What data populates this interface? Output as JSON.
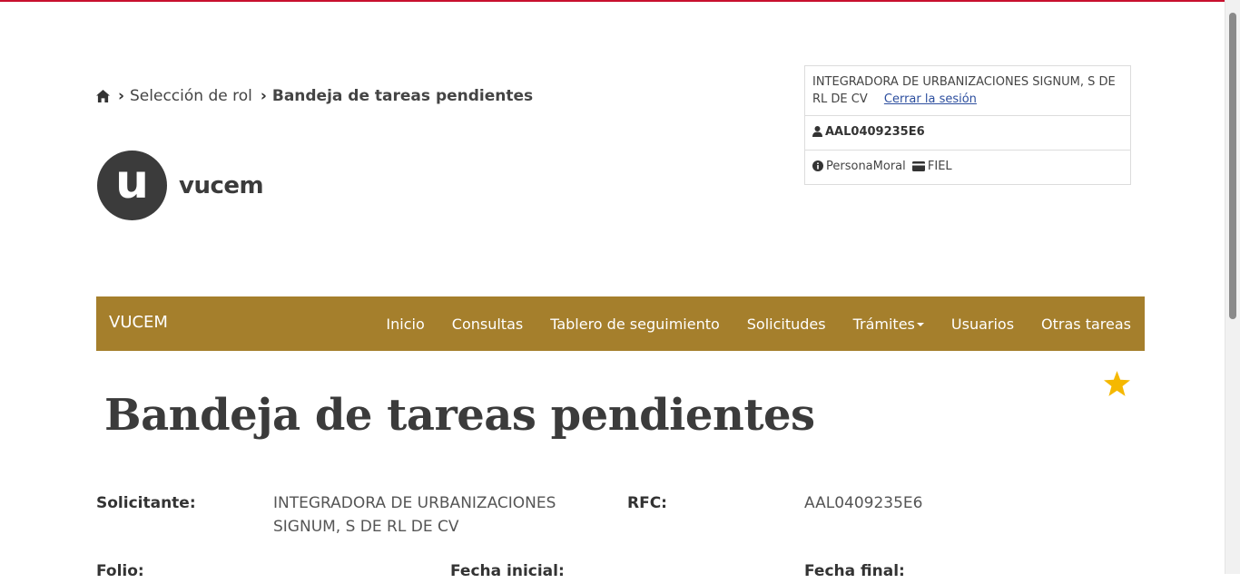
{
  "breadcrumb": {
    "items": [
      "Selección de rol",
      "Bandeja de tareas pendientes"
    ]
  },
  "logo": {
    "letter": "u",
    "text": "vucem"
  },
  "user_panel": {
    "company": "INTEGRADORA DE URBANIZACIONES SIGNUM, S DE RL DE CV",
    "logout_label": "Cerrar la sesión",
    "rfc": "AAL0409235E6",
    "person_type": "PersonaMoral",
    "auth_type": "FIEL"
  },
  "navbar": {
    "brand": "VUCEM",
    "items": [
      "Inicio",
      "Consultas",
      "Tablero de seguimiento",
      "Solicitudes",
      "Trámites",
      "Usuarios",
      "Otras tareas"
    ]
  },
  "page": {
    "title": "Bandeja de tareas pendientes",
    "favorite_icon": "star-icon"
  },
  "details": {
    "solicitante_label": "Solicitante:",
    "solicitante_value": "INTEGRADORA DE URBANIZACIONES SIGNUM, S DE RL DE CV",
    "rfc_label": "RFC:",
    "rfc_value": "AAL0409235E6",
    "folio_label": "Folio:",
    "fecha_inicial_label": "Fecha inicial:",
    "fecha_final_label": "Fecha final:"
  },
  "colors": {
    "navbar": "#a57f2c",
    "top_accent": "#c8102e",
    "star": "#f5b800",
    "link": "#2c4e9e"
  }
}
